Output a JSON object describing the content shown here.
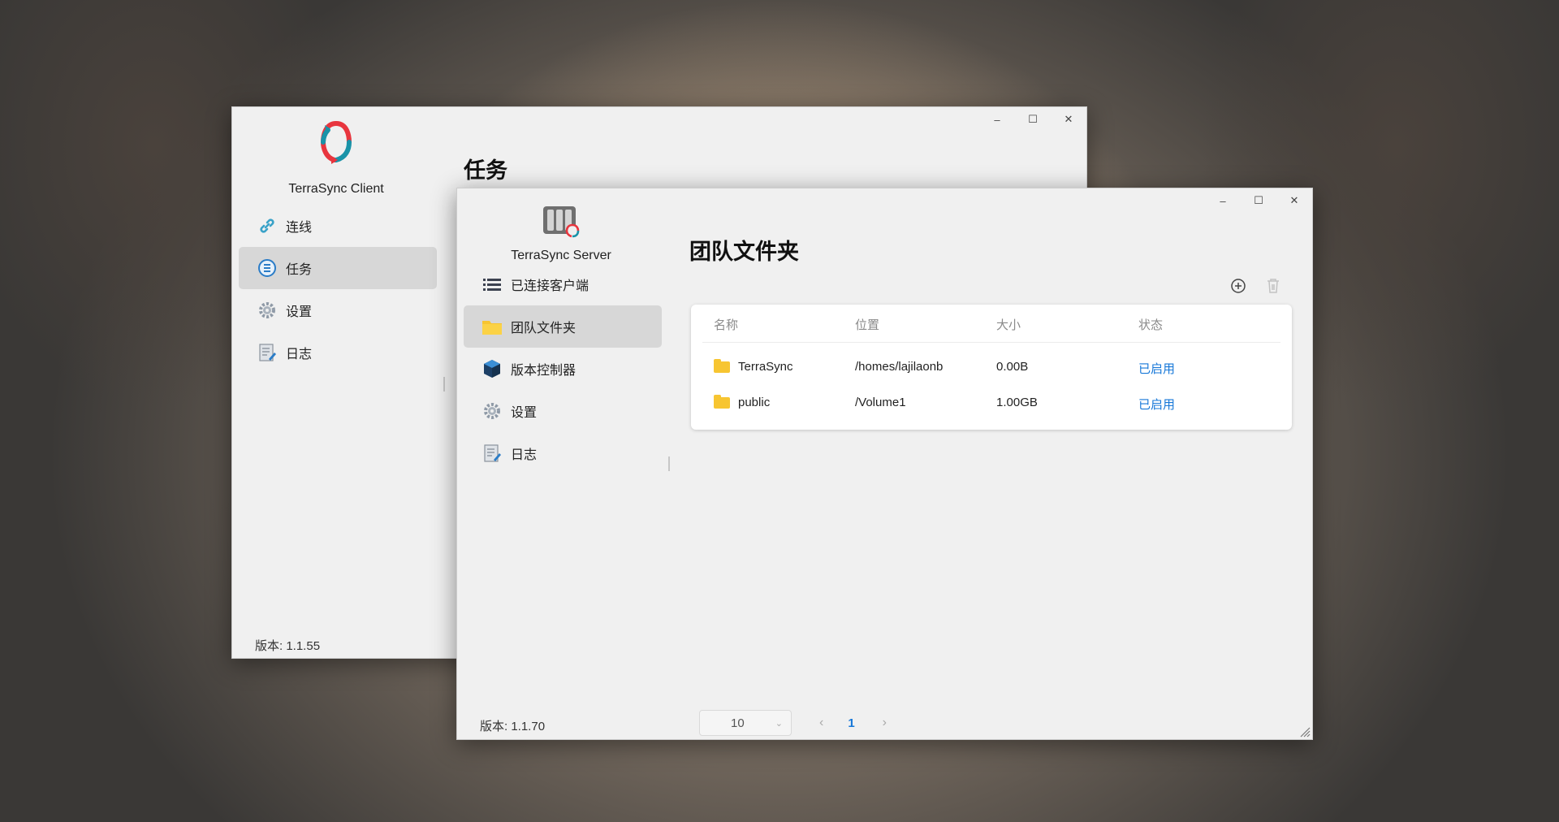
{
  "client": {
    "app_name": "TerraSync Client",
    "page_title": "任务",
    "nav": [
      {
        "label": "连线",
        "icon": "link-icon"
      },
      {
        "label": "任务",
        "icon": "tasks-icon"
      },
      {
        "label": "设置",
        "icon": "gear-icon"
      },
      {
        "label": "日志",
        "icon": "log-icon"
      }
    ],
    "active_nav": "任务",
    "version": "版本: 1.1.55"
  },
  "server": {
    "app_name": "TerraSync Server",
    "page_title": "团队文件夹",
    "nav": [
      {
        "label": "已连接客户端",
        "icon": "list-icon"
      },
      {
        "label": "团队文件夹",
        "icon": "folder-icon"
      },
      {
        "label": "版本控制器",
        "icon": "cube-icon"
      },
      {
        "label": "设置",
        "icon": "gear-icon"
      },
      {
        "label": "日志",
        "icon": "log-icon"
      }
    ],
    "active_nav": "团队文件夹",
    "version": "版本: 1.1.70",
    "table": {
      "columns": [
        "名称",
        "位置",
        "大小",
        "状态"
      ],
      "rows": [
        {
          "name": "TerraSync",
          "location": "/homes/lajilaonb",
          "size": "0.00B",
          "status": "已启用"
        },
        {
          "name": "public",
          "location": "/Volume1",
          "size": "1.00GB",
          "status": "已启用"
        }
      ]
    },
    "pagination": {
      "page_size": "10",
      "current_page": "1"
    }
  },
  "window_controls": {
    "minimize": "–",
    "maximize": "☐",
    "close": "✕"
  },
  "colors": {
    "accent": "#1677d8",
    "folder": "#f7c531",
    "logo_red": "#e8353e",
    "logo_teal": "#1a93a8"
  }
}
